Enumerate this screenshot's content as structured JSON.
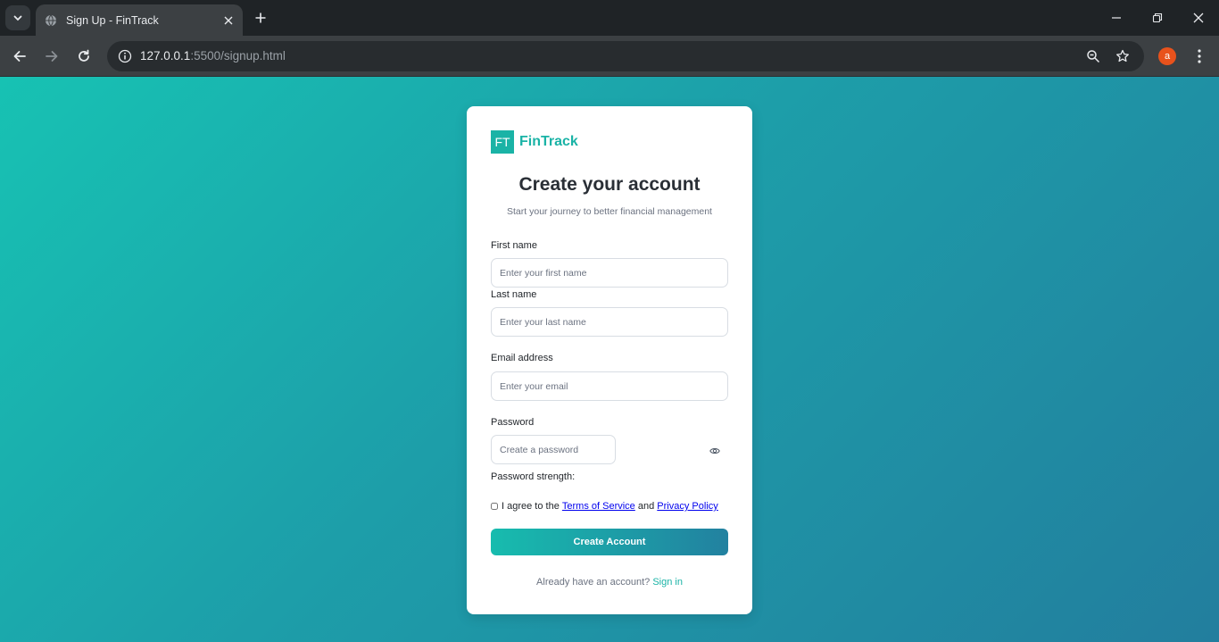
{
  "browser": {
    "tab_title": "Sign Up - FinTrack",
    "url_host": "127.0.0.1",
    "url_rest": ":5500/signup.html",
    "profile_initial": "a"
  },
  "signup": {
    "brand_mark": "FT",
    "brand_name": "FinTrack",
    "title": "Create your account",
    "subtitle": "Start your journey to better financial management",
    "first_name_label": "First name",
    "first_name_placeholder": "Enter your first name",
    "last_name_label": "Last name",
    "last_name_placeholder": "Enter your last name",
    "email_label": "Email address",
    "email_placeholder": "Enter your email",
    "password_label": "Password",
    "password_placeholder": "Create a password",
    "strength_label": "Password strength:",
    "agree_prefix": "I agree to the",
    "terms_link": "Terms of Service",
    "agree_and": "and",
    "privacy_link": "Privacy Policy",
    "submit_label": "Create Account",
    "signin_prompt": "Already have an account?",
    "signin_link": "Sign in"
  },
  "colors": {
    "accent": "#1ab3a6",
    "gradient_start": "#17c2b3",
    "gradient_end": "#227e9e"
  }
}
